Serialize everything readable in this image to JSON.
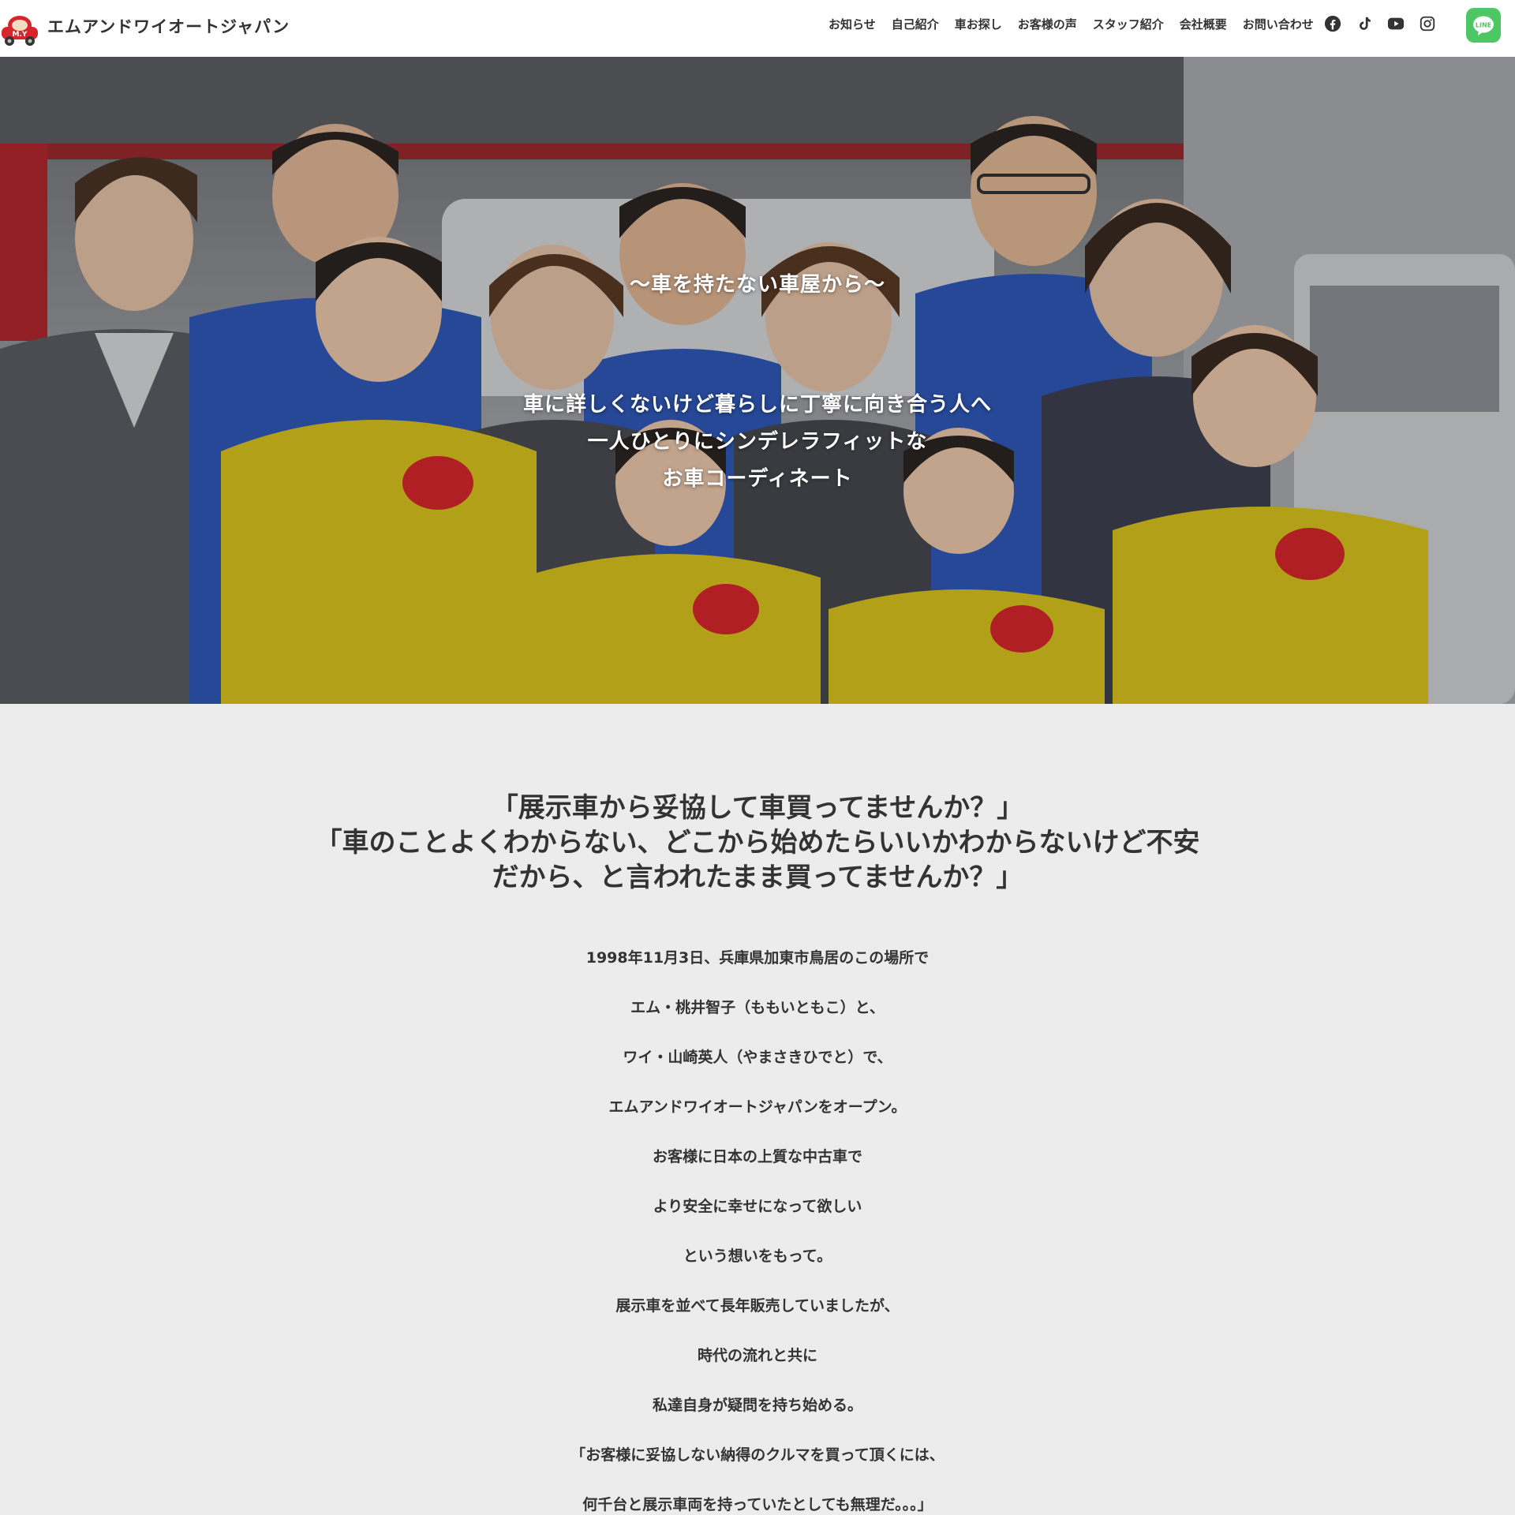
{
  "header": {
    "site_title": "エムアンドワイオートジャパン",
    "nav": [
      "お知らせ",
      "自己紹介",
      "車お探し",
      "お客様の声",
      "スタッフ紹介",
      "会社概要",
      "お問い合わせ"
    ],
    "social_icons": [
      "facebook-icon",
      "tiktok-icon",
      "youtube-icon",
      "instagram-icon"
    ],
    "line_label": "LINE",
    "line_color": "#4cc764"
  },
  "hero": {
    "subtitle": "〜車を持たない車屋から〜",
    "lines": [
      "車に詳しくないけど暮らしに丁寧に向き合う人へ",
      "一人ひとりにシンデレラフィットな",
      "お車コーディネート"
    ]
  },
  "lead": {
    "lines": [
      "「展示車から妥協して車買ってませんか？」",
      "「車のことよくわからない、どこから始めたらいいかわからないけど不安",
      "だから、と言われたまま買ってませんか？」"
    ]
  },
  "story": {
    "paragraphs": [
      "1998年11月3日、兵庫県加東市鳥居のこの場所で",
      "エム・桃井智子（ももいともこ）と、",
      "ワイ・山崎英人（やまさきひでと）で、",
      "エムアンドワイオートジャパンをオープン。",
      "お客様に日本の上質な中古車で",
      "より安全に幸せになって欲しい",
      "という想いをもって。",
      "展示車を並べて長年販売していましたが、",
      "時代の流れと共に",
      "私達自身が疑問を持ち始める。",
      "「お客様に妥協しない納得のクルマを買って頂くには、",
      "何千台と展示車両を持っていたとしても無理だ。。。」"
    ]
  },
  "colors": {
    "background": "#ececec",
    "header_bg": "#ffffff",
    "text": "#333333",
    "hoodie_yellow": "#d9c41f",
    "uniform_blue": "#2f58b8"
  }
}
